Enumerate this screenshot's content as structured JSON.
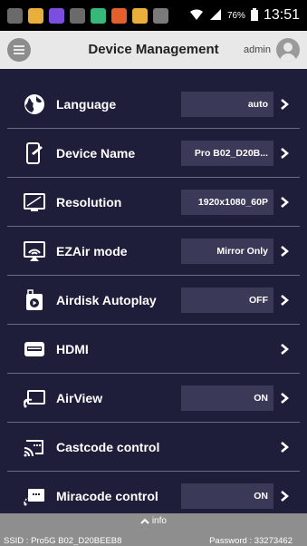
{
  "status_bar": {
    "battery": "76%",
    "time": "13:51",
    "app_icons": [
      "#6a6a6a",
      "#e8b03b",
      "#7b4ee0",
      "#6a6a6a",
      "#37b87a",
      "#e45f2b",
      "#e8b03b",
      "#7a7a7a"
    ]
  },
  "header": {
    "title": "Device Management",
    "user": "admin"
  },
  "settings": [
    {
      "name": "language",
      "icon": "globe-icon",
      "label": "Language",
      "value": "auto"
    },
    {
      "name": "device-name",
      "icon": "device-edit-icon",
      "label": "Device Name",
      "value": "Pro B02_D20B..."
    },
    {
      "name": "resolution",
      "icon": "monitor-icon",
      "label": "Resolution",
      "value": "1920x1080_60P"
    },
    {
      "name": "ezair-mode",
      "icon": "cast-icon",
      "label": "EZAir mode",
      "value": "Mirror Only"
    },
    {
      "name": "airdisk-autoplay",
      "icon": "play-card-icon",
      "label": "Airdisk Autoplay",
      "value": "OFF"
    },
    {
      "name": "hdmi",
      "icon": "hdmi-icon",
      "label": "HDMI",
      "value": null
    },
    {
      "name": "airview",
      "icon": "airview-icon",
      "label": "AirView",
      "value": "ON"
    },
    {
      "name": "castcode-control",
      "icon": "castcode-icon",
      "label": "Castcode control",
      "value": null
    },
    {
      "name": "miracode-control",
      "icon": "miracode-icon",
      "label": "Miracode control",
      "value": "ON"
    }
  ],
  "footer": {
    "info": "info",
    "ssid": "SSID : Pro5G B02_D20BEEB8",
    "password": "Password : 33273462"
  }
}
